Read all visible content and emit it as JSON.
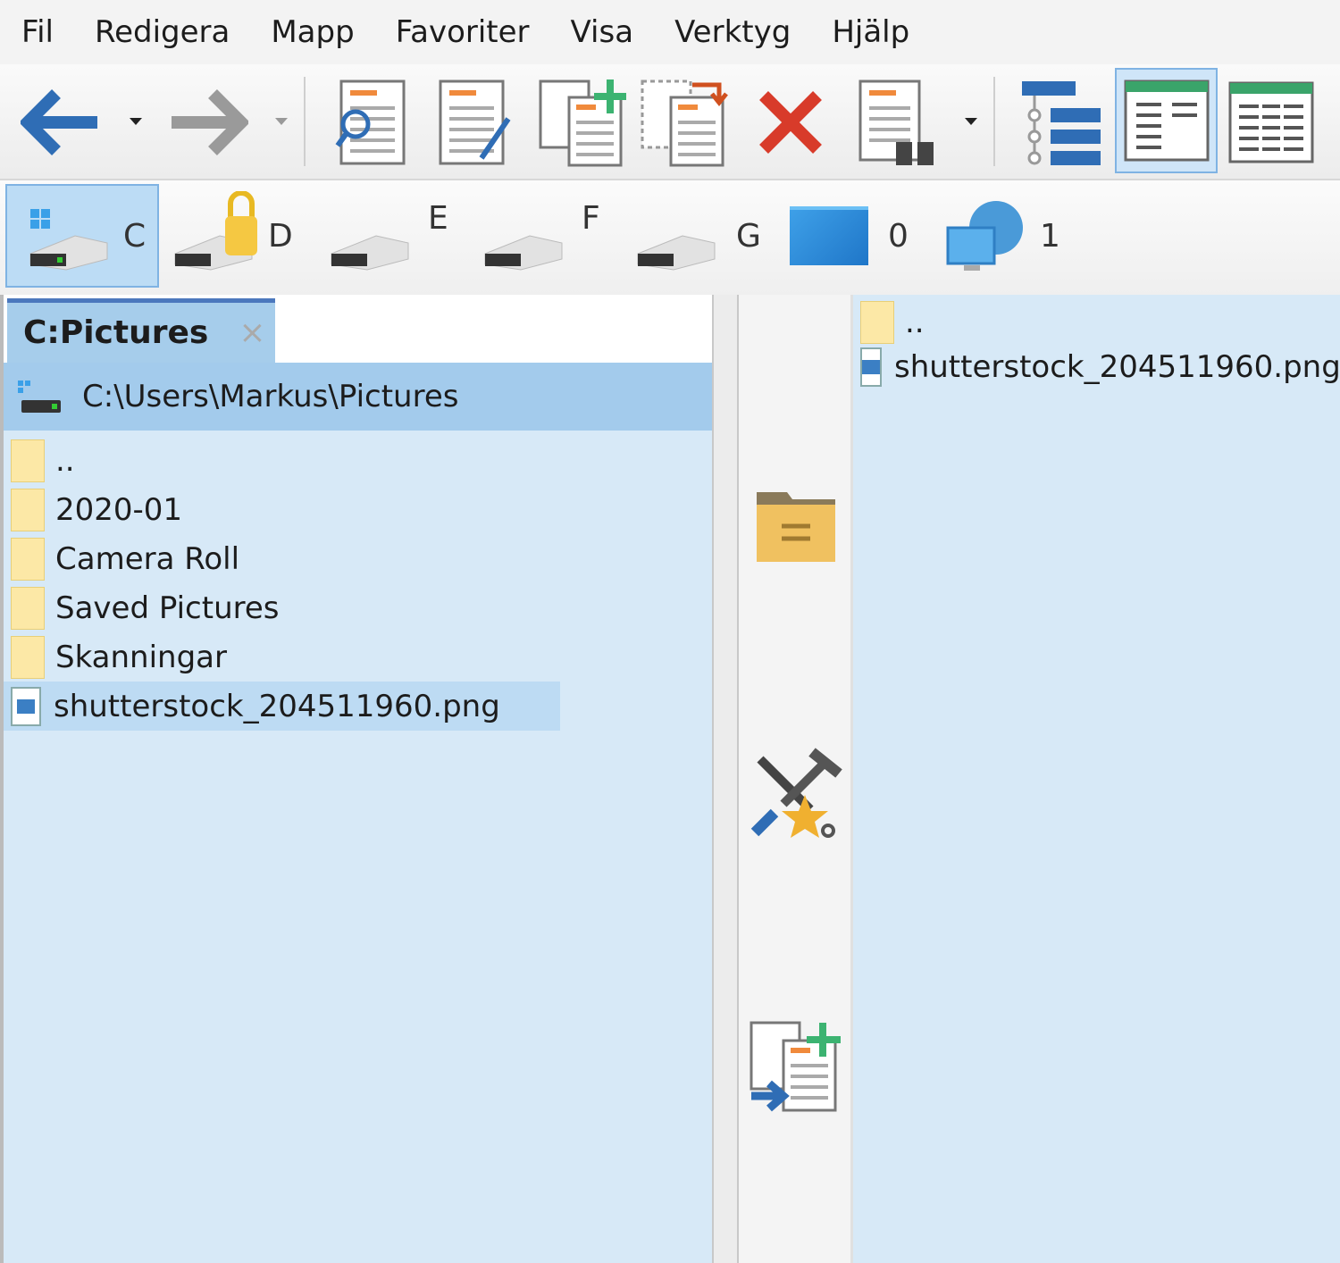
{
  "menu": [
    "Fil",
    "Redigera",
    "Mapp",
    "Favoriter",
    "Visa",
    "Verktyg",
    "Hjälp"
  ],
  "drives": [
    {
      "label": "C"
    },
    {
      "label": "D"
    },
    {
      "label": "E"
    },
    {
      "label": "F"
    },
    {
      "label": "G"
    },
    {
      "label": "0"
    },
    {
      "label": "1"
    }
  ],
  "left": {
    "tab_label": "C:Pictures",
    "tab_close": "×",
    "path": "C:\\Users\\Markus\\Pictures",
    "items": [
      {
        "name": "..",
        "type": "folder"
      },
      {
        "name": "2020-01",
        "type": "folder"
      },
      {
        "name": "Camera Roll",
        "type": "folder"
      },
      {
        "name": "Saved Pictures",
        "type": "folder"
      },
      {
        "name": "Skanningar",
        "type": "folder"
      },
      {
        "name": "shutterstock_204511960.png",
        "type": "image"
      }
    ]
  },
  "right": {
    "items": [
      {
        "name": "..",
        "type": "folder"
      },
      {
        "name": "shutterstock_204511960.png",
        "type": "image"
      }
    ]
  }
}
